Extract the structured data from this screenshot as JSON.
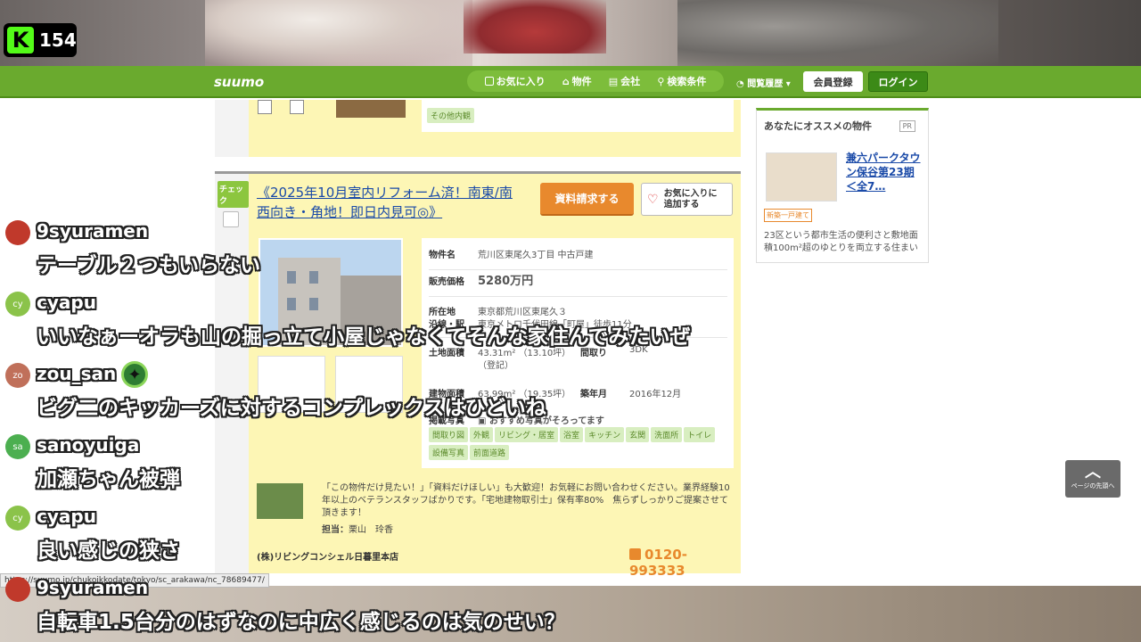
{
  "stream": {
    "platform": "K",
    "viewer_count": "154"
  },
  "suumo": {
    "logo": "suumo",
    "nav": [
      "お気に入り",
      "物件",
      "会社",
      "検索条件"
    ],
    "history": "閲覧履歴",
    "register": "会員登録",
    "login": "ログイン"
  },
  "prev_listing": {
    "tags": [
      "その他内観"
    ]
  },
  "listing": {
    "check_label": "チェック",
    "title": "《2025年10月室内リフォーム済！南東/南西向き・角地！即日内見可◎》",
    "request_button": "資料請求する",
    "fav_button_line1": "お気に入りに",
    "fav_button_line2": "追加する",
    "property_name_label": "物件名",
    "property_name": "荒川区東尾久3丁目 中古戸建",
    "price_label": "販売価格",
    "price": "5280万円",
    "address_label": "所在地",
    "address": "東京都荒川区東尾久３",
    "line_label": "沿線・駅",
    "line": "東京メトロ千代田線「町屋」徒歩11分",
    "land_label": "土地面積",
    "land": "43.31m² （13.10坪）",
    "land_note": "（登記）",
    "layout_label": "間取り",
    "layout": "3DK",
    "building_label": "建物面積",
    "building": "63.99m² （19.35坪）",
    "built_label": "築年月",
    "built": "2016年12月",
    "photos_label": "掲載写真",
    "photos_rec": "おすすめ写真がそろってます",
    "tags": [
      "間取り図",
      "外観",
      "リビング・居室",
      "浴室",
      "キッチン",
      "玄関",
      "洗面所",
      "トイレ",
      "設備写真",
      "前面道路"
    ],
    "agent_comment": "「この物件だけ見たい！」「資料だけほしい」も大歓迎！お気軽にお問い合わせください。業界経験10年以上のベテランスタッフばかりです。「宅地建物取引士」保有率80%　焦らずしっかりご提案させて頂きます！",
    "agent_label": "担当：",
    "agent_name": "栗山　玲香",
    "company": "(株)リビングコンシェル日暮里本店",
    "phone": "0120-993333"
  },
  "sidebar": {
    "title": "あなたにオススメの物件",
    "pr": "PR",
    "link": "兼六パークタウン保谷第23期＜全7…",
    "tag": "新築一戸建て",
    "desc": "23区という都市生活の便利さと敷地面積100m²超のゆとりを両立する住まい"
  },
  "to_top": {
    "label": "ページの先頭へ"
  },
  "url_status": "https://suumo.jp/chukoikkodate/tokyo/sc_arakawa/nc_78689477/",
  "chat": [
    {
      "user": "9syuramen",
      "avatar": "",
      "avatar_color": "#c0392b",
      "text": "テーブル２つもいらない"
    },
    {
      "user": "cyapu",
      "avatar": "cy",
      "avatar_color": "#8bc34a",
      "text": "いいなぁーオラも山の掘っ立て小屋じゃなくてそんな家住んでみたいぜ"
    },
    {
      "user": "zou_san",
      "avatar": "zo",
      "avatar_color": "#c0705a",
      "text": "ビグ二のキッカーズに対するコンプレックスはひどいね"
    },
    {
      "user": "sanoyuiga",
      "avatar": "sa",
      "avatar_color": "#4caf50",
      "text": "加瀬ちゃん被弾"
    },
    {
      "user": "cyapu",
      "avatar": "cy",
      "avatar_color": "#8bc34a",
      "text": "良い感じの狭さ"
    },
    {
      "user": "9syuramen",
      "avatar": "",
      "avatar_color": "#c0392b",
      "text": "自転車1.5台分のはずなのに中広く感じるのは気のせい？"
    }
  ]
}
